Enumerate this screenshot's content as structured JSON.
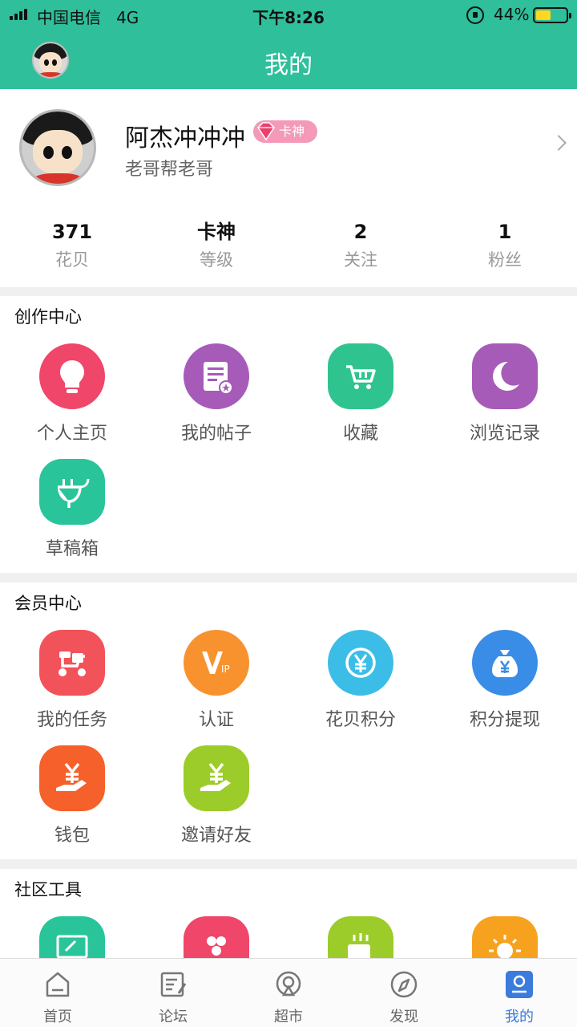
{
  "status_bar": {
    "carrier": "中国电信",
    "network": "4G",
    "time": "下午8:26",
    "battery": "44%"
  },
  "header": {
    "title": "我的"
  },
  "profile": {
    "username": "阿杰冲冲冲",
    "badge": "卡神",
    "subtitle": "老哥帮老哥",
    "stats": [
      {
        "value": "371",
        "label": "花贝"
      },
      {
        "value": "卡神",
        "label": "等级"
      },
      {
        "value": "2",
        "label": "关注"
      },
      {
        "value": "1",
        "label": "粉丝"
      }
    ]
  },
  "creation_center": {
    "title": "创作中心",
    "items": [
      {
        "label": "个人主页",
        "icon": "lightbulb-icon",
        "color": "#f0466a"
      },
      {
        "label": "我的帖子",
        "icon": "post-document-icon",
        "color": "#a65bb8"
      },
      {
        "label": "收藏",
        "icon": "shopping-cart-icon",
        "color": "#2fc48f"
      },
      {
        "label": "浏览记录",
        "icon": "moon-icon",
        "color": "#a65bb8"
      },
      {
        "label": "草稿箱",
        "icon": "plug-icon",
        "color": "#2ac49a"
      }
    ]
  },
  "member_center": {
    "title": "会员中心",
    "items": [
      {
        "label": "我的任务",
        "icon": "scooter-icon",
        "color": "#f2525a"
      },
      {
        "label": "认证",
        "icon": "vip-icon",
        "color": "#f7922e"
      },
      {
        "label": "花贝积分",
        "icon": "yen-circle-icon",
        "color": "#3cbde7"
      },
      {
        "label": "积分提现",
        "icon": "money-bag-icon",
        "color": "#3a8de6"
      },
      {
        "label": "钱包",
        "icon": "yen-hand-icon",
        "color": "#f6602a"
      },
      {
        "label": "邀请好友",
        "icon": "yen-hand-icon",
        "color": "#9ccc2a"
      }
    ]
  },
  "community_tools": {
    "title": "社区工具",
    "colors": [
      "#2ac49a",
      "#f0466a",
      "#9ccc2a",
      "#f7a21e"
    ]
  },
  "tabbar": [
    {
      "label": "首页",
      "icon": "home-icon"
    },
    {
      "label": "论坛",
      "icon": "forum-icon"
    },
    {
      "label": "超市",
      "icon": "market-icon"
    },
    {
      "label": "发现",
      "icon": "compass-icon"
    },
    {
      "label": "我的",
      "icon": "profile-icon",
      "active": true
    }
  ]
}
